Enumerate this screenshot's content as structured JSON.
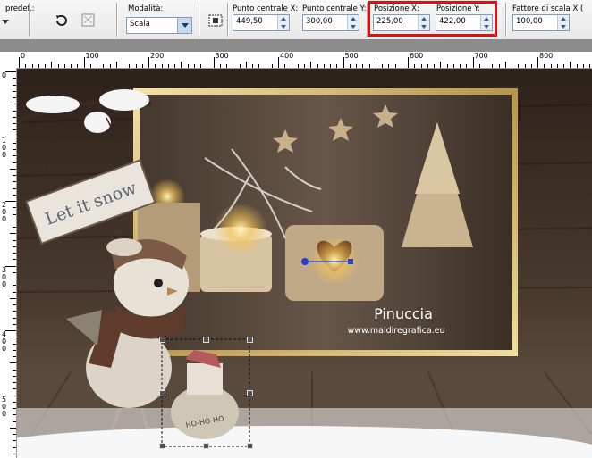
{
  "toolbar": {
    "preset_label": "predef.:",
    "mode_label": "Modalità:",
    "mode_value": "Scala",
    "center_x_label": "Punto centrale X:",
    "center_x_value": "449,50",
    "center_y_label": "Punto centrale Y:",
    "center_y_value": "300,00",
    "pos_x_label": "Posizione X:",
    "pos_x_value": "225,00",
    "pos_y_label": "Posizione Y:",
    "pos_y_value": "422,00",
    "scale_label": "Fattore di scala X (",
    "scale_value": "100,00",
    "highlight_color": "#e01010"
  },
  "ruler_top": {
    "labels": [
      "0",
      "100",
      "200",
      "300",
      "400",
      "500",
      "600",
      "700",
      "800"
    ]
  },
  "ruler_left": {
    "labels": [
      "0",
      "1\n0\n0",
      "2\n0\n0",
      "3\n0\n0",
      "4\n0\n0",
      "5\n0\n0"
    ]
  },
  "canvas": {
    "sign_text": "Let it snow",
    "watermark_name": "Pinuccia",
    "watermark_url": "www.maidiregrafica.eu",
    "sack_text": "HO-HO-HO"
  }
}
